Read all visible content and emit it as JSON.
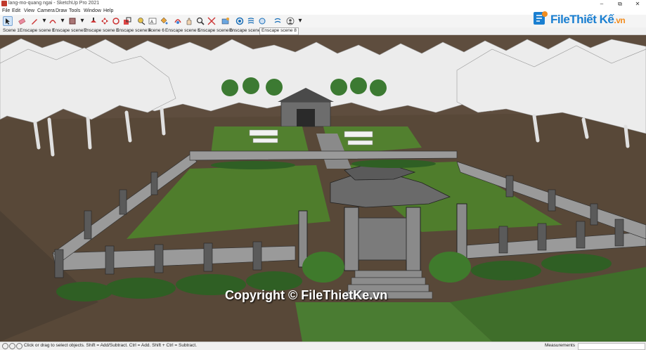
{
  "window": {
    "title": "lang-mo-quang ngai - SketchUp Pro 2021",
    "controls": {
      "minimize": "–",
      "maximize": "▢",
      "restore": "⧉",
      "close": "✕"
    }
  },
  "menu": [
    "File",
    "Edit",
    "View",
    "Camera",
    "Draw",
    "Tools",
    "Window",
    "Help"
  ],
  "toolbar": {
    "tools": [
      "select-arrow",
      "eraser",
      "pencil-line",
      "arc",
      "rectangle-shape",
      "push-pull",
      "move",
      "rotate",
      "scale",
      "tape-measure",
      "dimension-text",
      "paint-bucket",
      "orbit",
      "pan",
      "zoom",
      "zoom-extents",
      "section-plane",
      "styles",
      "enscape",
      "account"
    ]
  },
  "scenes": [
    "Scene 1",
    "Enscape scene 1",
    "Enscape scene 2",
    "Enscape scene 3",
    "Enscape scene 4",
    "Scene 6",
    "Enscape scene 5",
    "Enscape scene 6",
    "Enscape scene 7",
    "Enscape scene 8"
  ],
  "active_scene": "Enscape scene 8",
  "status": {
    "message": "Click or drag to select objects. Shift = Add/Subtract. Ctrl = Add. Shift + Ctrl = Subtract.",
    "measurements_label": "Measurements",
    "measurements_value": ""
  },
  "watermark": {
    "logo_file": "File",
    "logo_rest": "Thiết Kế",
    "logo_tld": ".vn",
    "copyright": "Copyright © FileThietKe.vn"
  },
  "colors": {
    "sky_tree": "#e6e6e6",
    "ground": "#5a4a3c",
    "grass": "#4f7d2c",
    "wall": "#8f8f8f",
    "logo_blue": "#1a7fd1",
    "logo_orange": "#f28c1e"
  }
}
